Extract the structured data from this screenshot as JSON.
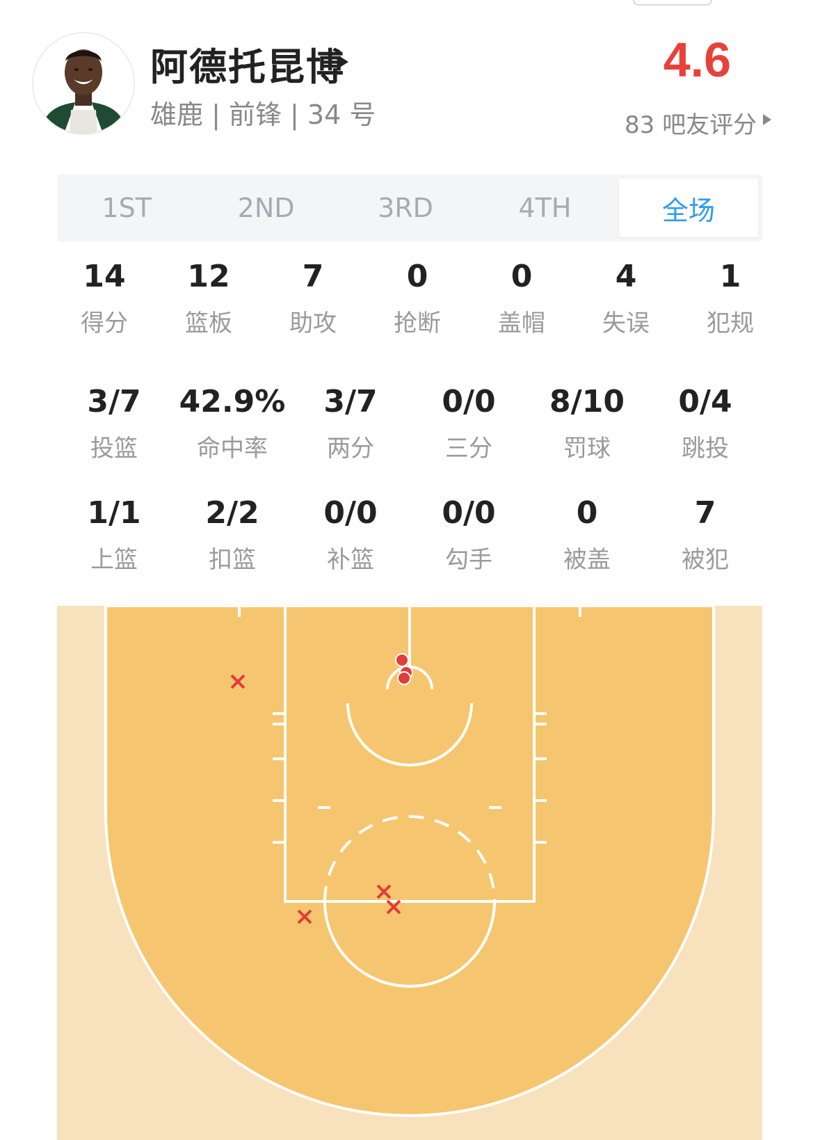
{
  "player": {
    "name": "阿德托昆博",
    "meta": "雄鹿 | 前锋 | 34 号",
    "rating": "4.6",
    "rating_count": "83 吧友评分"
  },
  "tabs": [
    "1ST",
    "2ND",
    "3RD",
    "4TH",
    "全场"
  ],
  "active_tab": "全场",
  "stats_row1": [
    {
      "value": "14",
      "label": "得分"
    },
    {
      "value": "12",
      "label": "篮板"
    },
    {
      "value": "7",
      "label": "助攻"
    },
    {
      "value": "0",
      "label": "抢断"
    },
    {
      "value": "0",
      "label": "盖帽"
    },
    {
      "value": "4",
      "label": "失误"
    },
    {
      "value": "1",
      "label": "犯规"
    }
  ],
  "stats_row2": [
    {
      "value": "3/7",
      "label": "投篮"
    },
    {
      "value": "42.9%",
      "label": "命中率"
    },
    {
      "value": "3/7",
      "label": "两分"
    },
    {
      "value": "0/0",
      "label": "三分"
    },
    {
      "value": "8/10",
      "label": "罚球"
    },
    {
      "value": "0/4",
      "label": "跳投"
    }
  ],
  "stats_row3": [
    {
      "value": "1/1",
      "label": "上篮"
    },
    {
      "value": "2/2",
      "label": "扣篮"
    },
    {
      "value": "0/0",
      "label": "补篮"
    },
    {
      "value": "0/0",
      "label": "勾手"
    },
    {
      "value": "0",
      "label": "被盖"
    },
    {
      "value": "7",
      "label": "被犯"
    }
  ],
  "shot_chart": {
    "made_count": 3,
    "missed_count": 4,
    "colors": {
      "court_inner": "#f5c66f",
      "court_outer": "#f8e1bd",
      "lines": "#ffffff",
      "made": "#e23b3b",
      "missed": "#e23b3b"
    }
  }
}
